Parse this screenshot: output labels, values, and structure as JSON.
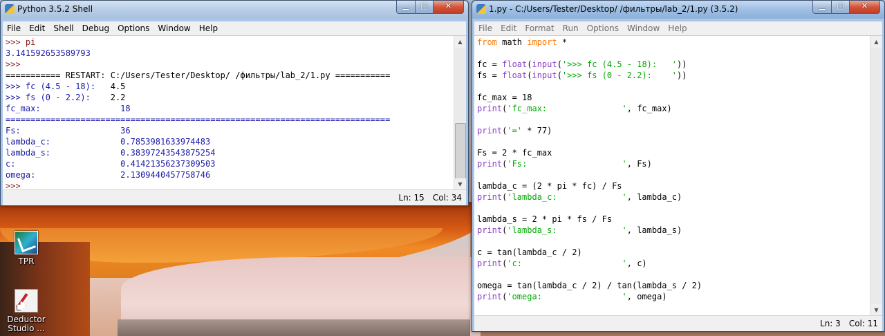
{
  "desktop": {
    "icons": [
      {
        "label": "TPR",
        "icon": "tpr-app-icon"
      },
      {
        "label": "Deductor Studio ...",
        "icon": "deductor-shortcut-icon"
      }
    ]
  },
  "shell_window": {
    "title": "Python 3.5.2 Shell",
    "menu": [
      "File",
      "Edit",
      "Shell",
      "Debug",
      "Options",
      "Window",
      "Help"
    ],
    "lines": [
      [
        {
          "t": ">>> pi",
          "c": "prompt"
        }
      ],
      [
        {
          "t": "3.141592653589793",
          "c": "out"
        }
      ],
      [
        {
          "t": ">>>",
          "c": "prompt"
        }
      ],
      [
        {
          "t": "=========== RESTART: C:/Users/Tester/Desktop/ /фильтры/lab_2/1.py ===========",
          "c": ""
        }
      ],
      [
        {
          "t": ">>> fc (4.5 - 18):   ",
          "c": "out"
        },
        {
          "t": "4.5",
          "c": ""
        }
      ],
      [
        {
          "t": ">>> fs (0 - 2.2):    ",
          "c": "out"
        },
        {
          "t": "2.2",
          "c": ""
        }
      ],
      [
        {
          "t": "fc_max:                18",
          "c": "out"
        }
      ],
      [
        {
          "t": "=============================================================================",
          "c": "out"
        }
      ],
      [
        {
          "t": "Fs:                    36",
          "c": "out"
        }
      ],
      [
        {
          "t": "lambda_c:              0.7853981633974483",
          "c": "out"
        }
      ],
      [
        {
          "t": "lambda_s:              0.38397243543875254",
          "c": "out"
        }
      ],
      [
        {
          "t": "c:                     0.41421356237309503",
          "c": "out"
        }
      ],
      [
        {
          "t": "omega:                 2.1309440457758746",
          "c": "out"
        }
      ],
      [
        {
          "t": ">>> ",
          "c": "prompt"
        }
      ]
    ],
    "status": {
      "ln": "Ln: 15",
      "col": "Col: 34"
    }
  },
  "editor_window": {
    "title": "1.py - C:/Users/Tester/Desktop/ /фильтры/lab_2/1.py (3.5.2)",
    "menu": [
      "File",
      "Edit",
      "Format",
      "Run",
      "Options",
      "Window",
      "Help"
    ],
    "lines": [
      [
        {
          "t": "from",
          "c": "kw"
        },
        {
          "t": " math ",
          "c": ""
        },
        {
          "t": "import",
          "c": "kw"
        },
        {
          "t": " *",
          "c": ""
        }
      ],
      [],
      [
        {
          "t": "fc = ",
          "c": ""
        },
        {
          "t": "float",
          "c": "bi"
        },
        {
          "t": "(",
          "c": ""
        },
        {
          "t": "input",
          "c": "bi"
        },
        {
          "t": "(",
          "c": ""
        },
        {
          "t": "'>>> fc (4.5 - 18):   '",
          "c": "str"
        },
        {
          "t": "))",
          "c": ""
        }
      ],
      [
        {
          "t": "fs = ",
          "c": ""
        },
        {
          "t": "float",
          "c": "bi"
        },
        {
          "t": "(",
          "c": ""
        },
        {
          "t": "input",
          "c": "bi"
        },
        {
          "t": "(",
          "c": ""
        },
        {
          "t": "'>>> fs (0 - 2.2):    '",
          "c": "str"
        },
        {
          "t": "))",
          "c": ""
        }
      ],
      [],
      [
        {
          "t": "fc_max = 18",
          "c": ""
        }
      ],
      [
        {
          "t": "print",
          "c": "bi"
        },
        {
          "t": "(",
          "c": ""
        },
        {
          "t": "'fc_max:               '",
          "c": "str"
        },
        {
          "t": ", fc_max)",
          "c": ""
        }
      ],
      [],
      [
        {
          "t": "print",
          "c": "bi"
        },
        {
          "t": "(",
          "c": ""
        },
        {
          "t": "'='",
          "c": "str"
        },
        {
          "t": " * 77)",
          "c": ""
        }
      ],
      [],
      [
        {
          "t": "Fs = 2 * fc_max",
          "c": ""
        }
      ],
      [
        {
          "t": "print",
          "c": "bi"
        },
        {
          "t": "(",
          "c": ""
        },
        {
          "t": "'Fs:                   '",
          "c": "str"
        },
        {
          "t": ", Fs)",
          "c": ""
        }
      ],
      [],
      [
        {
          "t": "lambda_c = (2 * pi * fc) / Fs",
          "c": ""
        }
      ],
      [
        {
          "t": "print",
          "c": "bi"
        },
        {
          "t": "(",
          "c": ""
        },
        {
          "t": "'lambda_c:             '",
          "c": "str"
        },
        {
          "t": ", lambda_c)",
          "c": ""
        }
      ],
      [],
      [
        {
          "t": "lambda_s = 2 * pi * fs / Fs",
          "c": ""
        }
      ],
      [
        {
          "t": "print",
          "c": "bi"
        },
        {
          "t": "(",
          "c": ""
        },
        {
          "t": "'lambda_s:             '",
          "c": "str"
        },
        {
          "t": ", lambda_s)",
          "c": ""
        }
      ],
      [],
      [
        {
          "t": "c = tan(lambda_c / 2)",
          "c": ""
        }
      ],
      [
        {
          "t": "print",
          "c": "bi"
        },
        {
          "t": "(",
          "c": ""
        },
        {
          "t": "'c:                    '",
          "c": "str"
        },
        {
          "t": ", c)",
          "c": ""
        }
      ],
      [],
      [
        {
          "t": "omega = tan(lambda_c / 2) / tan(lambda_s / 2)",
          "c": ""
        }
      ],
      [
        {
          "t": "print",
          "c": "bi"
        },
        {
          "t": "(",
          "c": ""
        },
        {
          "t": "'omega:                '",
          "c": "str"
        },
        {
          "t": ", omega)",
          "c": ""
        }
      ]
    ],
    "status": {
      "ln": "Ln: 3",
      "col": "Col: 11"
    }
  },
  "colors": {
    "keyword": "#ff7700",
    "builtin": "#8b3fc6",
    "string": "#00aa00",
    "output": "#1a1aa8",
    "prompt": "#8b1a1a"
  }
}
